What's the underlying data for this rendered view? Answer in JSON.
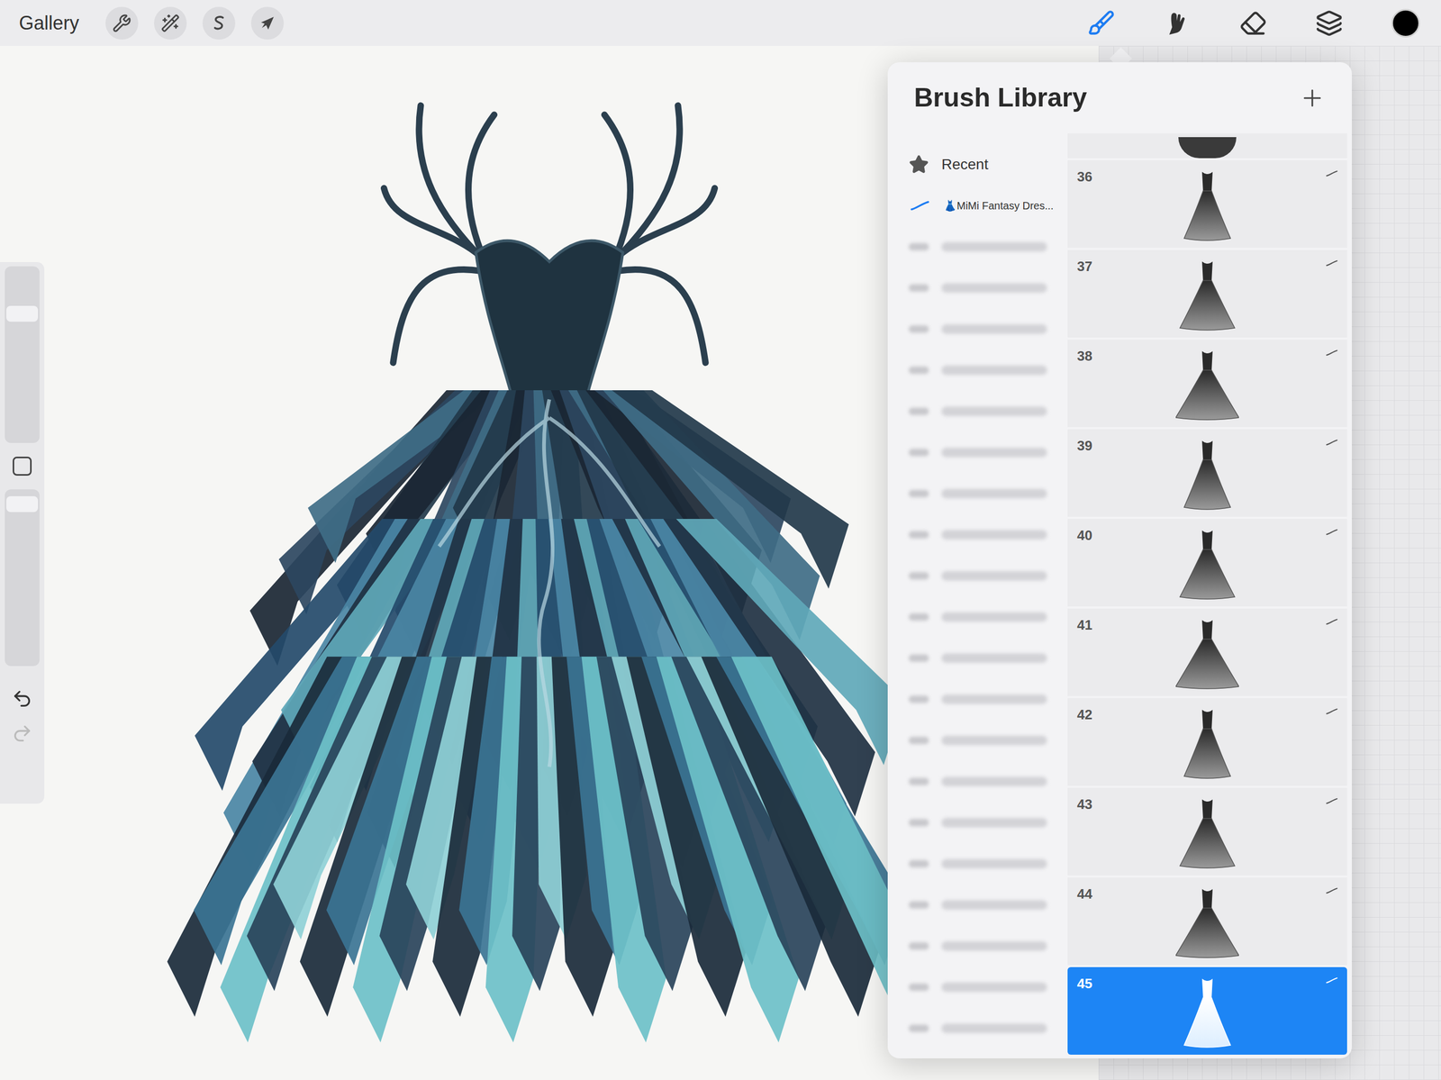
{
  "toolbar": {
    "gallery": "Gallery",
    "tools": [
      {
        "tool": "brush",
        "selected": true
      },
      {
        "tool": "smudge",
        "selected": false
      },
      {
        "tool": "eraser",
        "selected": false
      },
      {
        "tool": "layers",
        "selected": false
      }
    ],
    "current_color": "#000000"
  },
  "sidebar": {
    "size_level": 0.73,
    "opacity_level": 0.96,
    "undo_enabled": true,
    "redo_enabled": false
  },
  "brush_library": {
    "title": "Brush Library",
    "categories": [
      {
        "label": "Recent",
        "kind": "recent",
        "selected": false
      },
      {
        "label": "👗MiMi Fantasy Dres...",
        "kind": "set",
        "selected": true
      }
    ],
    "blurred_categories": 20,
    "brushes": [
      {
        "number": "36",
        "selected": false
      },
      {
        "number": "37",
        "selected": false
      },
      {
        "number": "38",
        "selected": false
      },
      {
        "number": "39",
        "selected": false
      },
      {
        "number": "40",
        "selected": false
      },
      {
        "number": "41",
        "selected": false
      },
      {
        "number": "42",
        "selected": false
      },
      {
        "number": "43",
        "selected": false
      },
      {
        "number": "44",
        "selected": false
      },
      {
        "number": "45",
        "selected": true
      }
    ]
  }
}
